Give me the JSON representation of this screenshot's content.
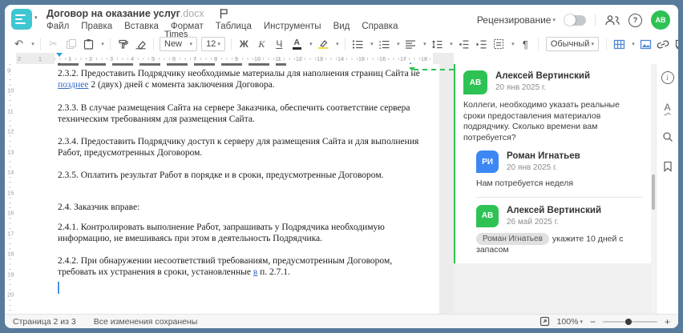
{
  "window": {
    "frame_color": "#587b9b",
    "title": "Договор на оказание услуг",
    "title_ext": ".docx"
  },
  "menu": {
    "items": [
      "Файл",
      "Правка",
      "Вставка",
      "Формат",
      "Таблица",
      "Инструменты",
      "Вид",
      "Справка"
    ]
  },
  "header": {
    "review_label": "Рецензирование",
    "review_toggle_on": false,
    "avatar_initials": "АВ",
    "avatar_color": "#2EC255"
  },
  "toolbar": {
    "font_name": "Times New ...",
    "font_size": "12",
    "bold_label": "Ж",
    "italic_label": "К",
    "underline_label": "Ч",
    "font_color_label": "А",
    "style_name": "Обычный",
    "pilcrow": "¶",
    "more_label": "⋯"
  },
  "icons": {
    "caret": "▾",
    "undo": "↶",
    "cut": "✂"
  },
  "hruler": {
    "margin_numbers": [
      "2",
      "1"
    ],
    "numbers": [
      "1",
      "2",
      "3",
      "4",
      "5",
      "6",
      "7",
      "8",
      "9",
      "10",
      "11",
      "12",
      "13",
      "14",
      "15",
      "16",
      "17",
      "18"
    ]
  },
  "vruler": {
    "numbers": [
      "9",
      "10",
      "11",
      "12",
      "13",
      "14",
      "15",
      "16",
      "17",
      "18",
      "19",
      "20"
    ]
  },
  "document": {
    "p232_a": "2.3.2. Предоставить Подрядчику необходимые материалы для наполнения страниц Сайта не ",
    "p232_ins": "позднее",
    "p232_b": " 2 (двух) дней с момента заключения Договора.",
    "p233": "2.3.3. В случае размещения Сайта на сервере Заказчика, обеспечить соответствие сервера техническим требованиям для размещения Сайта.",
    "p234": "2.3.4. Предоставить Подрядчику доступ к серверу для размещения Сайта и для выполнения Работ, предусмотренных Договором.",
    "p235": "2.3.5. Оплатить результат Работ в порядке и в сроки, предусмотренные Договором.",
    "p24": "2.4. Заказчик вправе:",
    "p241": "2.4.1. Контролировать выполнение Работ, запрашивать у Подрядчика необходимую информацию, не вмешиваясь при этом в деятельность Подрядчика.",
    "p242_a": "2.4.2. При обнаружении несоответствий требованиям, предусмотренным Договором, требовать их устранения в сроки, установленные ",
    "p242_ins": "в",
    "p242_b": " п. 2.7.1.",
    "tracked_change_color": "#3B6BC4"
  },
  "comments": [
    {
      "initials": "АВ",
      "author": "Алексей Вертинский",
      "date": "20 янв 2025 г.",
      "text": "Коллеги, необходимо указать реальные сроки предоставления материалов подрядчику. Сколько времени вам потребуется?"
    },
    {
      "initials": "РИ",
      "author": "Роман Игнатьев",
      "date": "20 янв 2025 г.",
      "text": "Нам потребуется неделя"
    },
    {
      "initials": "АВ",
      "author": "Алексей Вертинский",
      "date": "26 май 2025 г.",
      "mention": "Роман Игнатьев",
      "text": "укажите 10 дней с запасом"
    }
  ],
  "status_bar": {
    "page_label": "Страница 2 из 3",
    "saved_label": "Все изменения сохранены",
    "zoom_level": "100%"
  },
  "colors": {
    "accent_green": "#2EC255",
    "accent_blue": "#3D87F5",
    "logo_teal": "#3FC6D3",
    "ruler_marker_blue": "#2DA0DC"
  }
}
